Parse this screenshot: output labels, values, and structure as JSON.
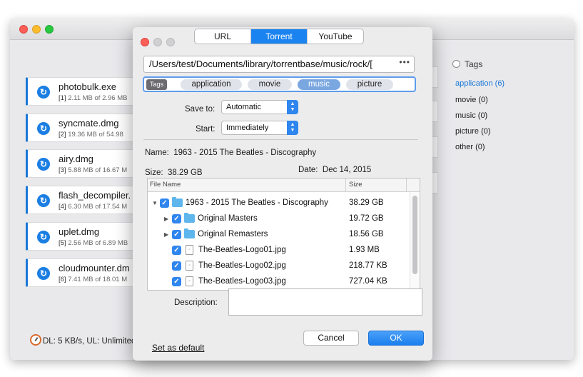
{
  "downloads": [
    {
      "name": "photobulk.exe",
      "index": "[1]",
      "info": "2.11 MB of 2.96 MB"
    },
    {
      "name": "syncmate.dmg",
      "index": "[2]",
      "info": "19.36 MB of 54.98"
    },
    {
      "name": "airy.dmg",
      "index": "[3]",
      "info": "5.88 MB of 16.67 M"
    },
    {
      "name": "flash_decompiler.",
      "index": "[4]",
      "info": "6.30 MB of 17.54 M"
    },
    {
      "name": "uplet.dmg",
      "index": "[5]",
      "info": "2.56 MB of 6.89 MB"
    },
    {
      "name": "cloudmounter.dm",
      "index": "[6]",
      "info": "7.41 MB of 18.01 M"
    }
  ],
  "status": {
    "text": "DL: 5 KB/s, UL: Unlimited"
  },
  "tags_panel": {
    "header": "Tags",
    "items": [
      {
        "label": "application (6)",
        "selected": true
      },
      {
        "label": "movie (0)",
        "selected": false
      },
      {
        "label": "music (0)",
        "selected": false
      },
      {
        "label": "picture (0)",
        "selected": false
      },
      {
        "label": "other (0)",
        "selected": false
      }
    ]
  },
  "dialog": {
    "tabs": [
      {
        "label": "URL",
        "active": false
      },
      {
        "label": "Torrent",
        "active": true
      },
      {
        "label": "YouTube",
        "active": false
      }
    ],
    "path": "/Users/test/Documents/library/torrentbase/music/rock/[",
    "path_more": "•••",
    "tags_label": "Tags",
    "tags": [
      {
        "label": "application",
        "selected": false
      },
      {
        "label": "movie",
        "selected": false
      },
      {
        "label": "music",
        "selected": true
      },
      {
        "label": "picture",
        "selected": false
      }
    ],
    "save_to_label": "Save to:",
    "save_to_value": "Automatic",
    "start_label": "Start:",
    "start_value": "Immediately",
    "name_label": "Name:",
    "name_value": "1963 - 2015 The Beatles - Discography",
    "size_label": "Size:",
    "size_value": "38.29 GB",
    "date_label": "Date:",
    "date_value": "Dec 14, 2015",
    "columns": {
      "name": "File Name",
      "size": "Size"
    },
    "files": [
      {
        "name": "1963 - 2015 The Beatles - Discography",
        "size": "38.29 GB"
      },
      {
        "name": "Original Masters",
        "size": "19.72 GB"
      },
      {
        "name": "Original Remasters",
        "size": "18.56 GB"
      },
      {
        "name": "The-Beatles-Logo01.jpg",
        "size": "1.93 MB"
      },
      {
        "name": "The-Beatles-Logo02.jpg",
        "size": "218.77 KB"
      },
      {
        "name": "The-Beatles-Logo03.jpg",
        "size": "727.04 KB"
      }
    ],
    "description_label": "Description:",
    "set_default_label": "Set as default",
    "cancel_label": "Cancel",
    "ok_label": "OK"
  },
  "colors": {
    "accent": "#1b83f0",
    "progress_bar": "#1a78d6",
    "selected_tag": "#7aa7e0"
  }
}
